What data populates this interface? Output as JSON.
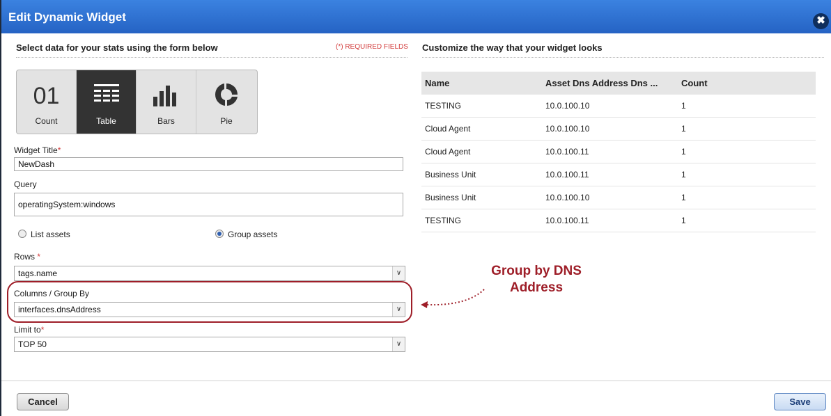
{
  "dialog": {
    "title": "Edit Dynamic Widget",
    "close_label": "✖"
  },
  "form": {
    "section_title": "Select data for your stats using the form below",
    "required_note": "(*) REQUIRED FIELDS",
    "viz_types": [
      {
        "label": "Count",
        "glyph": "01",
        "selected": false
      },
      {
        "label": "Table",
        "glyph": "table-icon",
        "selected": true
      },
      {
        "label": "Bars",
        "glyph": "bars-icon",
        "selected": false
      },
      {
        "label": "Pie",
        "glyph": "pie-icon",
        "selected": false
      }
    ],
    "widget_title_label": "Widget Title",
    "widget_title_value": "NewDash",
    "query_label": "Query",
    "query_value": "operatingSystem:windows",
    "radio_list": "List assets",
    "radio_group": "Group assets",
    "radio_selected": "group",
    "rows_label": "Rows",
    "rows_value": "tags.name",
    "columns_label": "Columns / Group By",
    "columns_value": "interfaces.dnsAddress",
    "limit_label": "Limit to",
    "limit_value": "TOP 50",
    "required_star": "*"
  },
  "preview": {
    "section_title": "Customize the way that your widget looks",
    "columns": [
      "Name",
      "Asset Dns Address Dns ...",
      "Count"
    ],
    "rows": [
      [
        "TESTING",
        "10.0.100.10",
        "1"
      ],
      [
        "Cloud Agent",
        "10.0.100.10",
        "1"
      ],
      [
        "Cloud Agent",
        "10.0.100.11",
        "1"
      ],
      [
        "Business Unit",
        "10.0.100.11",
        "1"
      ],
      [
        "Business Unit",
        "10.0.100.10",
        "1"
      ],
      [
        "TESTING",
        "10.0.100.11",
        "1"
      ]
    ]
  },
  "annotation": {
    "line1": "Group by DNS",
    "line2": "Address",
    "color": "#9e1e28"
  },
  "footer": {
    "cancel_label": "Cancel",
    "save_label": "Save"
  },
  "colors": {
    "title_bar": "#2b6ed1",
    "selected_viz": "#333333",
    "required": "#d23b3b"
  }
}
